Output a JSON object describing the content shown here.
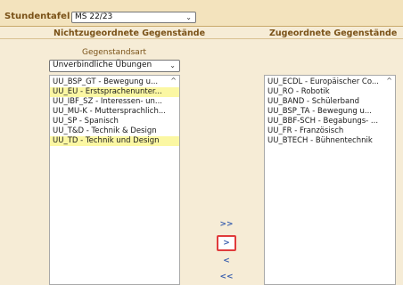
{
  "header": {
    "label": "Stundentafel",
    "select_value": "MS 22/23"
  },
  "columns": {
    "left_title": "Nichtzugeordnete Gegenstände",
    "right_title": "Zugeordnete Gegenstände"
  },
  "filter": {
    "label": "Gegenstandsart",
    "select_value": "Unverbindliche Übungen"
  },
  "left_list": [
    {
      "label": "UÜ_BSP_GT - Bewegung u..."
    },
    {
      "label": "UÜ_EU - Erstsprachenunter..."
    },
    {
      "label": "UÜ_IBF_SZ - Interessen- un..."
    },
    {
      "label": "UÜ_MU-K - Muttersprachlich..."
    },
    {
      "label": "UÜ_SP - Spanisch"
    },
    {
      "label": "UÜ_T&D - Technik & Design"
    },
    {
      "label": "UÜ_TD - Technik und Design"
    }
  ],
  "right_list": [
    {
      "label": "UÜ_ECDL - Europäischer Co..."
    },
    {
      "label": "UÜ_RO - Robotik"
    },
    {
      "label": "UÜ_BAND - Schülerband"
    },
    {
      "label": "UÜ_BSP_TA - Bewegung u..."
    },
    {
      "label": "UÜ_BBF-SCH - Begabungs- ..."
    },
    {
      "label": "UÜ_FR - Französisch"
    },
    {
      "label": "UÜ_BTECH - Bühnentechnik"
    }
  ],
  "buttons": {
    "move_all_right": ">>",
    "move_right": ">",
    "move_left": "<",
    "move_all_left": "<<"
  },
  "icons": {
    "dropdown": "chevron-down-icon",
    "scroll_up": "scroll-up-arrow-icon"
  },
  "colors": {
    "highlight": "#fbf7a3",
    "header_text": "#7a5218",
    "active_button_border": "#e03c3c"
  }
}
